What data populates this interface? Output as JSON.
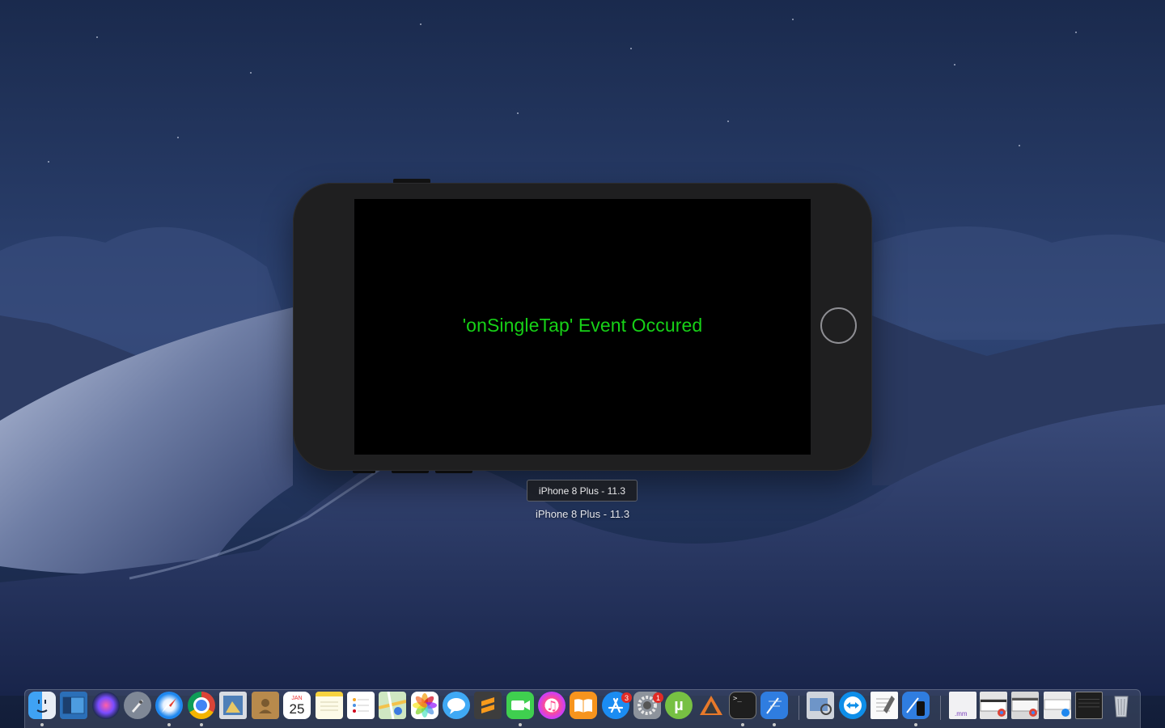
{
  "simulator": {
    "screen_text": "'onSingleTap' Event Occured",
    "tooltip": "iPhone 8 Plus - 11.3",
    "device_label": "iPhone 8 Plus - 11.3"
  },
  "dock": {
    "calendar": {
      "month": "JAN",
      "day": "25"
    },
    "app_store_badge": "3",
    "system_prefs_badge": "1",
    "items": [
      "finder-icon",
      "launchpad-folder-icon",
      "siri-icon",
      "rocket-icon",
      "safari-icon",
      "chrome-icon",
      "preview-icon",
      "contacts-icon",
      "calendar-icon",
      "notes-icon",
      "reminders-icon",
      "maps-icon",
      "photos-icon",
      "messages-icon",
      "sublime-text-icon",
      "facetime-icon",
      "itunes-icon",
      "ibooks-icon",
      "app-store-icon",
      "system-preferences-icon",
      "utorrent-icon",
      "instruments-icon",
      "terminal-icon",
      "xcode-icon",
      "preview-images-icon",
      "teamviewer-icon",
      "textedit-icon",
      "simulator-icon",
      "mm-file-icon",
      "chrome-window-icon",
      "chrome-window-2-icon",
      "safari-window-icon",
      "terminal-window-icon",
      "trash-icon"
    ]
  },
  "colors": {
    "event_text": "#17d117",
    "phone_body": "#1f1f20",
    "screen": "#000000",
    "badge": "#e02b26"
  }
}
